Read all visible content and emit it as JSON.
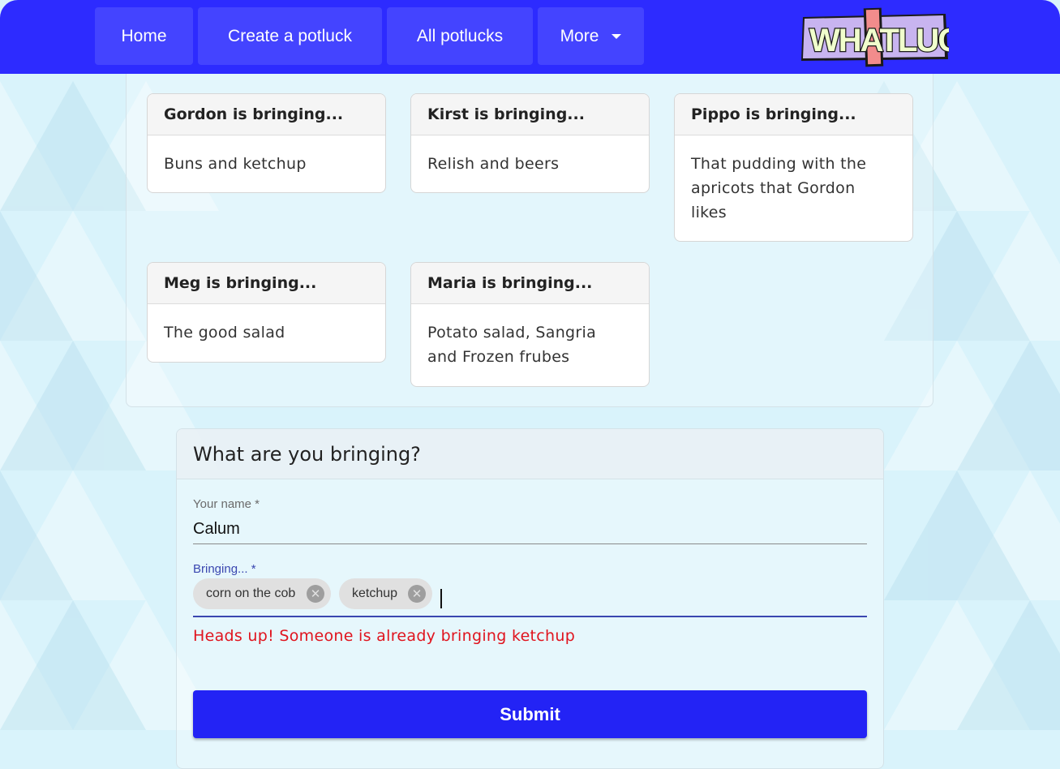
{
  "nav": {
    "items": [
      {
        "label": "Home"
      },
      {
        "label": "Create a potluck"
      },
      {
        "label": "All potlucks"
      },
      {
        "label": "More"
      }
    ],
    "logo_text": "WHATLUCK"
  },
  "contributions": [
    {
      "heading": "Gordon is bringing...",
      "item": "Buns and ketchup"
    },
    {
      "heading": "Kirst is bringing...",
      "item": "Relish and beers"
    },
    {
      "heading": "Pippo is bringing...",
      "item": "That pudding with the apricots that Gordon likes"
    },
    {
      "heading": "Meg is bringing...",
      "item": "The good salad"
    },
    {
      "heading": "Maria is bringing...",
      "item": "Potato salad, Sangria and Frozen frubes"
    }
  ],
  "form": {
    "title": "What are you bringing?",
    "name_label": "Your name *",
    "name_value": "Calum",
    "bringing_label": "Bringing... *",
    "chips": [
      "corn on the cob",
      "ketchup"
    ],
    "warning": "Heads up! Someone is already bringing ketchup",
    "submit_label": "Submit"
  },
  "colors": {
    "nav_bg": "#2d2bff",
    "nav_button": "#4444ff",
    "submit": "#2323f5",
    "warning": "#e0141e",
    "focus_underline": "#3a47b0"
  }
}
